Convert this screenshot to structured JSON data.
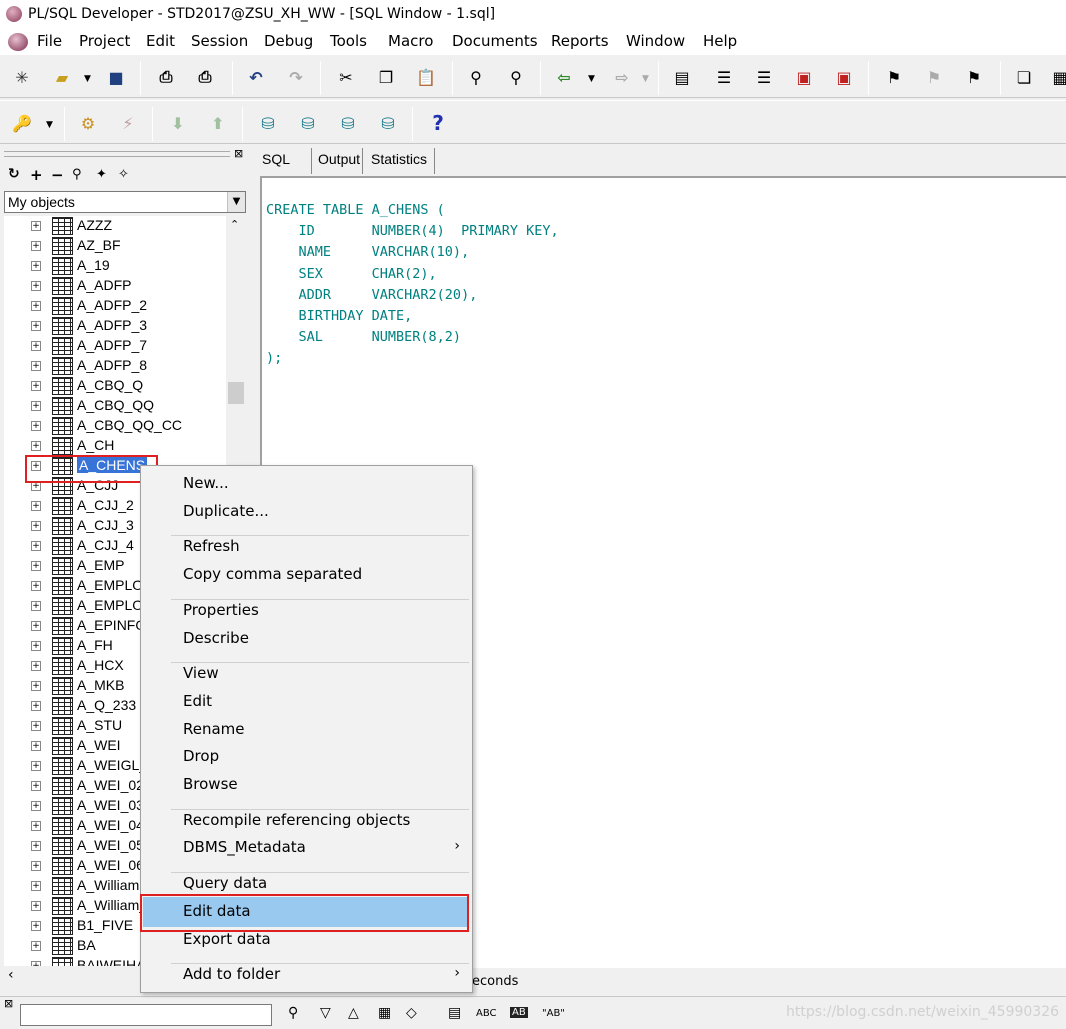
{
  "window": {
    "title": "PL/SQL Developer - STD2017@ZSU_XH_WW - [SQL Window - 1.sql]"
  },
  "menu": [
    "File",
    "Project",
    "Edit",
    "Session",
    "Debug",
    "Tools",
    "Macro",
    "Documents",
    "Reports",
    "Window",
    "Help"
  ],
  "left": {
    "filter": "My objects",
    "objects": [
      "AZZZ",
      "AZ_BF",
      "A_19",
      "A_ADFP",
      "A_ADFP_2",
      "A_ADFP_3",
      "A_ADFP_7",
      "A_ADFP_8",
      "A_CBQ_Q",
      "A_CBQ_QQ",
      "A_CBQ_QQ_CC",
      "A_CH",
      "A_CHENS",
      "A_CJJ",
      "A_CJJ_2",
      "A_CJJ_3",
      "A_CJJ_4",
      "A_EMP",
      "A_EMPLO",
      "A_EMPLO",
      "A_EPINFO",
      "A_FH",
      "A_HCX",
      "A_MKB",
      "A_Q_233",
      "A_STU",
      "A_WEI",
      "A_WEIGL_",
      "A_WEI_02",
      "A_WEI_03",
      "A_WEI_04",
      "A_WEI_05",
      "A_WEI_06",
      "A_William",
      "A_William_",
      "B1_FIVE",
      "BA",
      "BAIWEIHA"
    ],
    "selected": "A_CHENS"
  },
  "tabs": [
    "SQL",
    "Output",
    "Statistics"
  ],
  "editor": {
    "code": "CREATE TABLE A_CHENS (\n    ID       NUMBER(4)  PRIMARY KEY,\n    NAME     VARCHAR(10),\n    SEX      CHAR(2),\n    ADDR     VARCHAR2(20),\n    BIRTHDAY DATE,\n    SAL      NUMBER(8,2)\n);"
  },
  "status": {
    "text": "econds"
  },
  "toolbar2": {
    "help": "?"
  },
  "context_menu": {
    "items": [
      {
        "label": "New...",
        "group": 1
      },
      {
        "label": "Duplicate...",
        "group": 1
      },
      {
        "label": "Refresh",
        "group": 2
      },
      {
        "label": "Copy comma separated",
        "group": 2
      },
      {
        "label": "Properties",
        "group": 3
      },
      {
        "label": "Describe",
        "group": 3
      },
      {
        "label": "View",
        "group": 4
      },
      {
        "label": "Edit",
        "group": 4
      },
      {
        "label": "Rename",
        "group": 4
      },
      {
        "label": "Drop",
        "group": 4
      },
      {
        "label": "Browse",
        "group": 4
      },
      {
        "label": "Recompile referencing objects",
        "group": 5
      },
      {
        "label": "DBMS_Metadata",
        "group": 5,
        "submenu": true
      },
      {
        "label": "Query data",
        "group": 6
      },
      {
        "label": "Edit data",
        "group": 6,
        "highlighted": true
      },
      {
        "label": "Export data",
        "group": 6
      },
      {
        "label": "Add to folder",
        "group": 7,
        "submenu": true
      }
    ]
  },
  "findbar": {
    "abc": "ABC",
    "ab": "AB",
    "quoted": "\"AB\""
  },
  "watermark": "https://blog.csdn.net/weixin_45990326"
}
